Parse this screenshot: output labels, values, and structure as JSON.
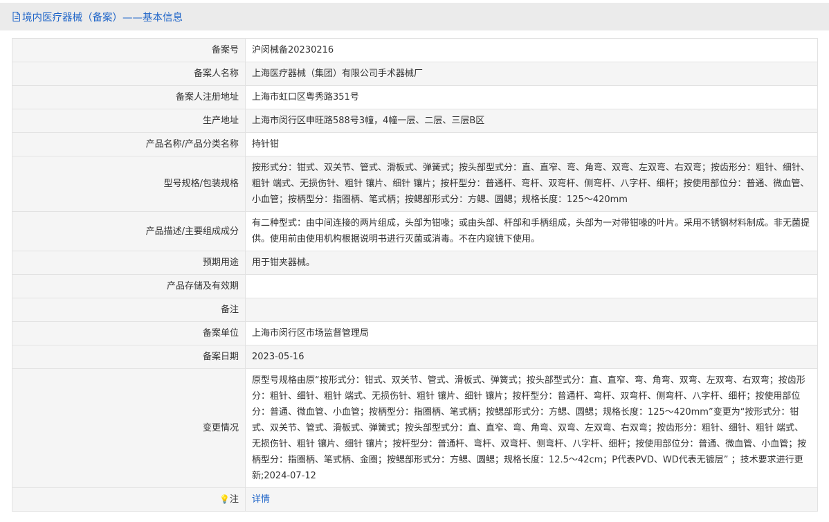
{
  "header": {
    "title": "境内医疗器械（备案）——基本信息",
    "accent_color": "#1e64c8",
    "icon": "document-icon"
  },
  "rows": [
    {
      "label": "备案号",
      "value": "沪闵械备20230216"
    },
    {
      "label": "备案人名称",
      "value": "上海医疗器械（集团）有限公司手术器械厂"
    },
    {
      "label": "备案人注册地址",
      "value": "上海市虹口区粤秀路351号"
    },
    {
      "label": "生产地址",
      "value": "上海市闵行区申旺路588号3幢，4幢一层、二层、三层B区"
    },
    {
      "label": "产品名称/产品分类名称",
      "value": "持针钳"
    },
    {
      "label": "型号规格/包装规格",
      "value": "按形式分：钳式、双关节、管式、滑板式、弹簧式；按头部型式分：直、直窄、弯、角弯、双弯、左双弯、右双弯；按齿形分：粗针、细针、粗针 端式、无损伤针、粗针 镶片、细针 镶片；按杆型分：普通杆、弯杆、双弯杆、侧弯杆、八字杆、细杆；按使用部位分：普通、微血管、小血管；按柄型分：指圈柄、笔式柄；按鳃部形式分：方鳃、圆鳃；规格长度：125～420mm"
    },
    {
      "label": "产品描述/主要组成成分",
      "value": "有二种型式：由中间连接的两片组成，头部为钳喙；或由头部、杆部和手柄组成，头部为一对带钳喙的叶片。采用不锈钢材料制成。非无菌提供。使用前由使用机构根据说明书进行灭菌或消毒。不在内窥镜下使用。"
    },
    {
      "label": "预期用途",
      "value": "用于钳夹器械。"
    },
    {
      "label": "产品存储及有效期",
      "value": ""
    },
    {
      "label": "备注",
      "value": ""
    },
    {
      "label": "备案单位",
      "value": "上海市闵行区市场监督管理局"
    },
    {
      "label": "备案日期",
      "value": "2023-05-16"
    },
    {
      "label": "变更情况",
      "value": "原型号规格由原“按形式分：钳式、双关节、管式、滑板式、弹簧式；按头部型式分：直、直窄、弯、角弯、双弯、左双弯、右双弯；按齿形分：粗针、细针、粗针 端式、无损伤针、粗针 镶片、细针 镶片；按杆型分：普通杆、弯杆、双弯杆、侧弯杆、八字杆、细杆；按使用部位分：普通、微血管、小血管；按柄型分：指圈柄、笔式柄；按鳃部形式分：方鳃、圆鳃；规格长度：125～420mm”变更为“按形式分：钳式、双关节、管式、滑板式、弹簧式；按头部型式分：直、直窄、弯、角弯、双弯、左双弯、右双弯；按齿形分：粗针、细针、粗针 端式、无损伤针、粗针 镶片、细针 镶片；按杆型分：普通杆、弯杆、双弯杆、侧弯杆、八字杆、细杆；按使用部位分：普通、微血管、小血管；按柄型分：指圈柄、笔式柄、金圈；按鳃部形式分：方鳃、圆鳃；规格长度：12.5～42cm；P代表PVD、WD代表无镀层” ；技术要求进行更新;2024-07-12"
    }
  ],
  "note_row": {
    "label": "注",
    "icon": "lightbulb-icon",
    "link_text": "详情"
  }
}
